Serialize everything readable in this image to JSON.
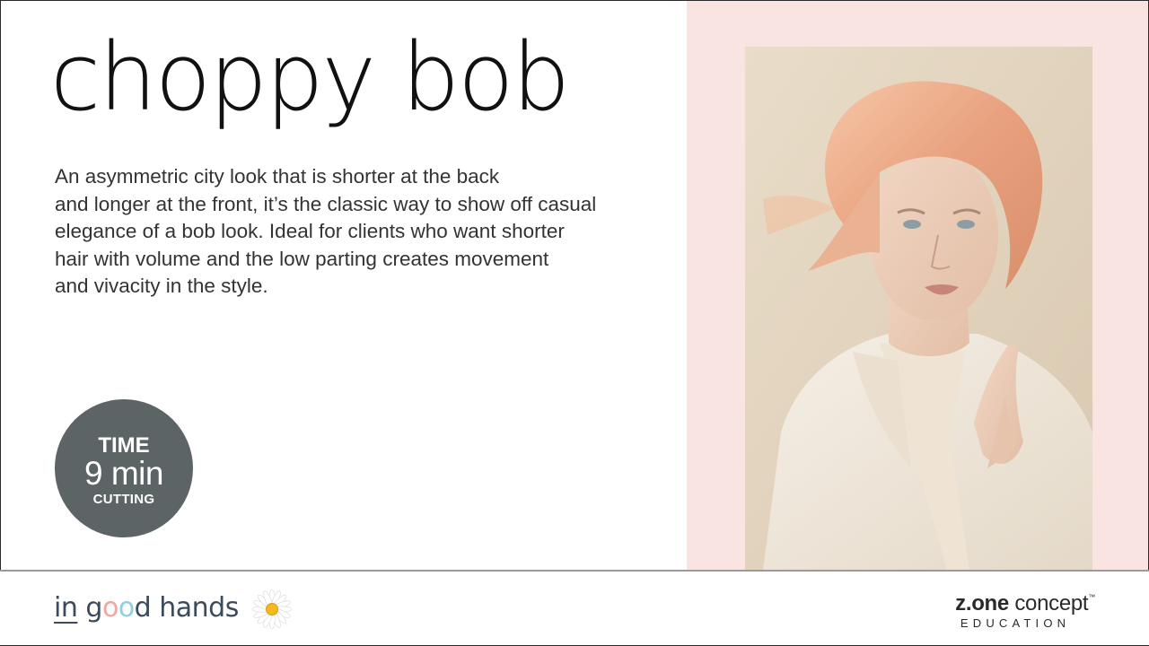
{
  "slide": {
    "title": "choppy bob",
    "description_lines": [
      "An asymmetric city look that is shorter at the back",
      "and longer at the front, it’s the classic way to show off casual",
      "elegance of a bob look. Ideal for clients who want shorter",
      "hair with volume and the low parting creates movement",
      "and vivacity in the style."
    ],
    "time_badge": {
      "label": "TIME",
      "value": "9 min",
      "note": "CUTTING"
    }
  },
  "footer": {
    "brand": {
      "word_in": "in",
      "word_good_g": "g",
      "word_good_o1": "o",
      "word_good_o2": "o",
      "word_good_d": "d",
      "word_hands": "hands"
    },
    "partner": {
      "bold": "z.one",
      "rest": " concept",
      "tm": "™",
      "subtitle": "EDUCATION"
    }
  },
  "colors": {
    "pink_panel": "#f9e4e2",
    "badge": "#5d6466",
    "brand_text": "#3b4a5c",
    "brand_pink": "#f0a6a1",
    "brand_blue": "#8ed0df"
  },
  "icons": [
    "daisy-icon"
  ]
}
